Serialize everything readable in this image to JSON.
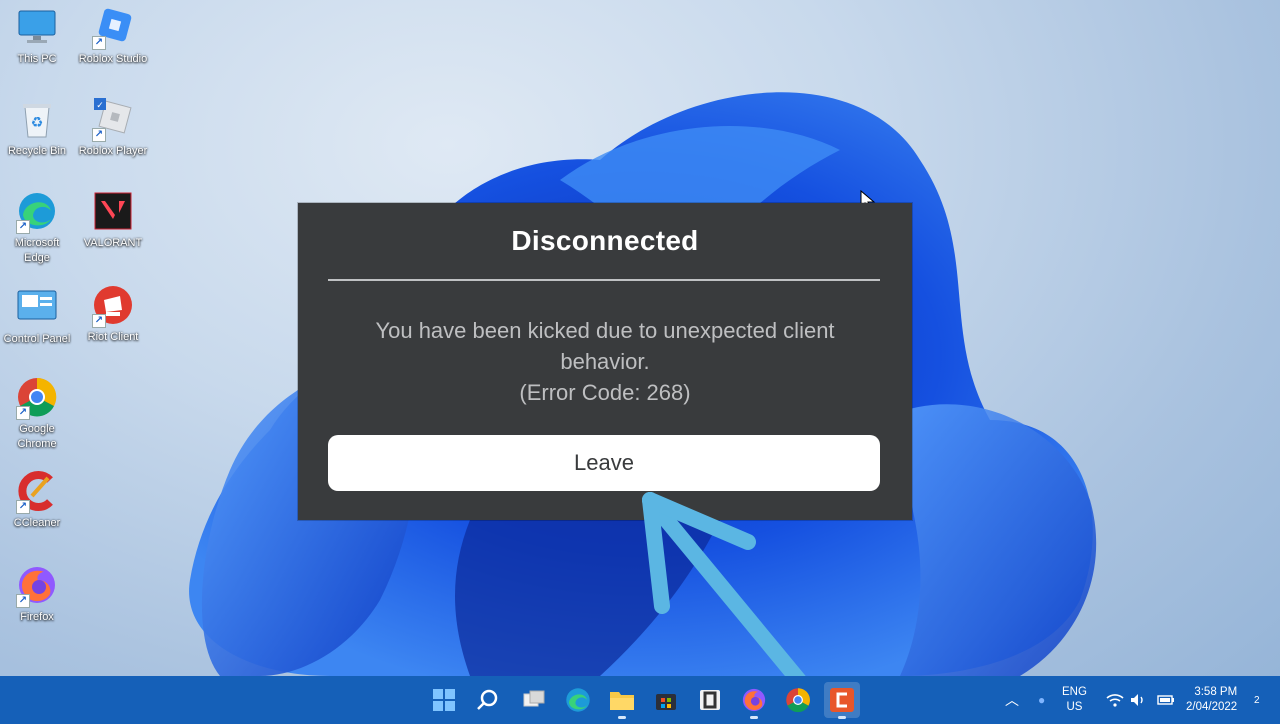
{
  "desktop": {
    "icons": [
      {
        "label": "This PC"
      },
      {
        "label": "Roblox Studio"
      },
      {
        "label": "Recycle Bin"
      },
      {
        "label": "Roblox Player"
      },
      {
        "label": "Microsoft Edge"
      },
      {
        "label": "VALORANT"
      },
      {
        "label": "Control Panel"
      },
      {
        "label": "Riot Client"
      },
      {
        "label": "Google Chrome"
      },
      {
        "label": "CCleaner"
      },
      {
        "label": "Firefox"
      }
    ]
  },
  "dialog": {
    "title": "Disconnected",
    "message_line1": "You have been kicked due to unexpected client",
    "message_line2": "behavior.",
    "error_code": "(Error Code: 268)",
    "button_label": "Leave"
  },
  "annotation": {
    "arrow_color": "#5bb6e3",
    "arrow_icon": "pointing-arrow-icon"
  },
  "taskbar": {
    "apps": [
      {
        "name": "start-icon"
      },
      {
        "name": "search-icon"
      },
      {
        "name": "task-view-icon"
      },
      {
        "name": "edge-icon"
      },
      {
        "name": "file-explorer-icon"
      },
      {
        "name": "store-icon"
      },
      {
        "name": "office-icon"
      },
      {
        "name": "firefox-icon"
      },
      {
        "name": "chrome-icon"
      },
      {
        "name": "camtasia-icon"
      }
    ],
    "tray": {
      "lang_line1": "ENG",
      "lang_line2": "US",
      "time": "3:58 PM",
      "date": "2/04/2022",
      "notification_count": "2"
    }
  },
  "colors": {
    "taskbar": "#1560b8",
    "dialog_bg": "#393b3d",
    "wallpaper_blue": "#1f5fe0"
  }
}
